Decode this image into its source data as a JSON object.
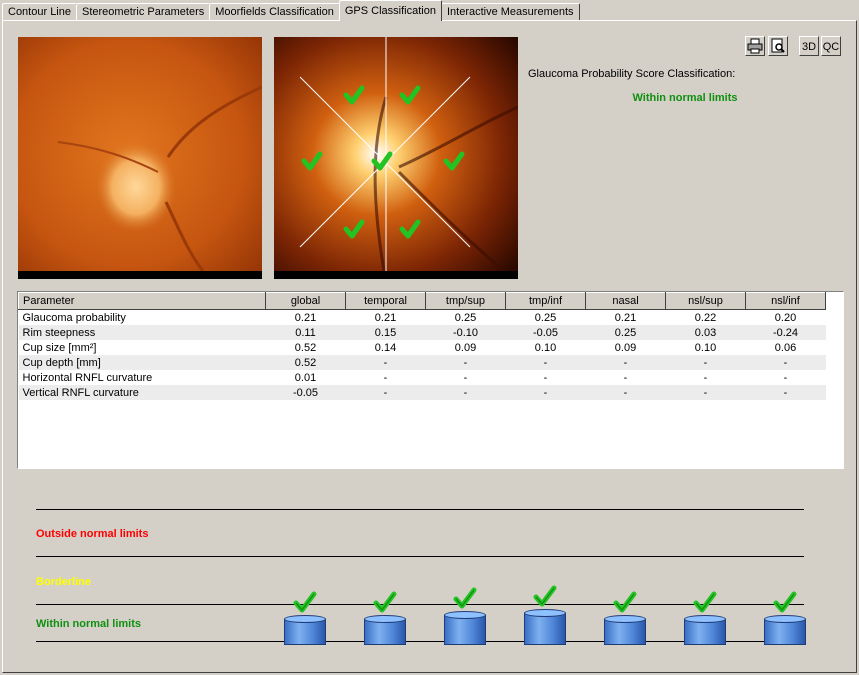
{
  "tabs": [
    {
      "label": "Contour Line",
      "active": false
    },
    {
      "label": "Stereometric Parameters",
      "active": false
    },
    {
      "label": "Moorfields Classification",
      "active": false
    },
    {
      "label": "GPS Classification",
      "active": true
    },
    {
      "label": "Interactive Measurements",
      "active": false
    }
  ],
  "toolbar": {
    "print_icon": "printer-icon",
    "preview_icon": "print-preview-icon",
    "btn_3d": "3D",
    "btn_qc": "QC"
  },
  "gps": {
    "title": "Glaucoma Probability Score Classification:",
    "result": "Within normal limits",
    "result_color": "#109010"
  },
  "table": {
    "headers": [
      "Parameter",
      "global",
      "temporal",
      "tmp/sup",
      "tmp/inf",
      "nasal",
      "nsl/sup",
      "nsl/inf"
    ],
    "rows": [
      [
        "Glaucoma probability",
        "0.21",
        "0.21",
        "0.25",
        "0.25",
        "0.21",
        "0.22",
        "0.20"
      ],
      [
        "Rim steepness",
        "0.11",
        "0.15",
        "-0.10",
        "-0.05",
        "0.25",
        "0.03",
        "-0.24"
      ],
      [
        "Cup size [mm²]",
        "0.52",
        "0.14",
        "0.09",
        "0.10",
        "0.09",
        "0.10",
        "0.06"
      ],
      [
        "Cup depth [mm]",
        "0.52",
        "-",
        "-",
        "-",
        "-",
        "-",
        "-"
      ],
      [
        "Horizontal RNFL curvature",
        "0.01",
        "-",
        "-",
        "-",
        "-",
        "-",
        "-"
      ],
      [
        "Vertical RNFL curvature",
        "-0.05",
        "-",
        "-",
        "-",
        "-",
        "-",
        "-"
      ]
    ]
  },
  "categories": {
    "outside": {
      "label": "Outside normal limits",
      "color": "#ff0000"
    },
    "borderline": {
      "label": "Borderline",
      "color": "#ffff00"
    },
    "within": {
      "label": "Within normal limits",
      "color": "#109010"
    }
  },
  "check_color": "#22c322"
}
